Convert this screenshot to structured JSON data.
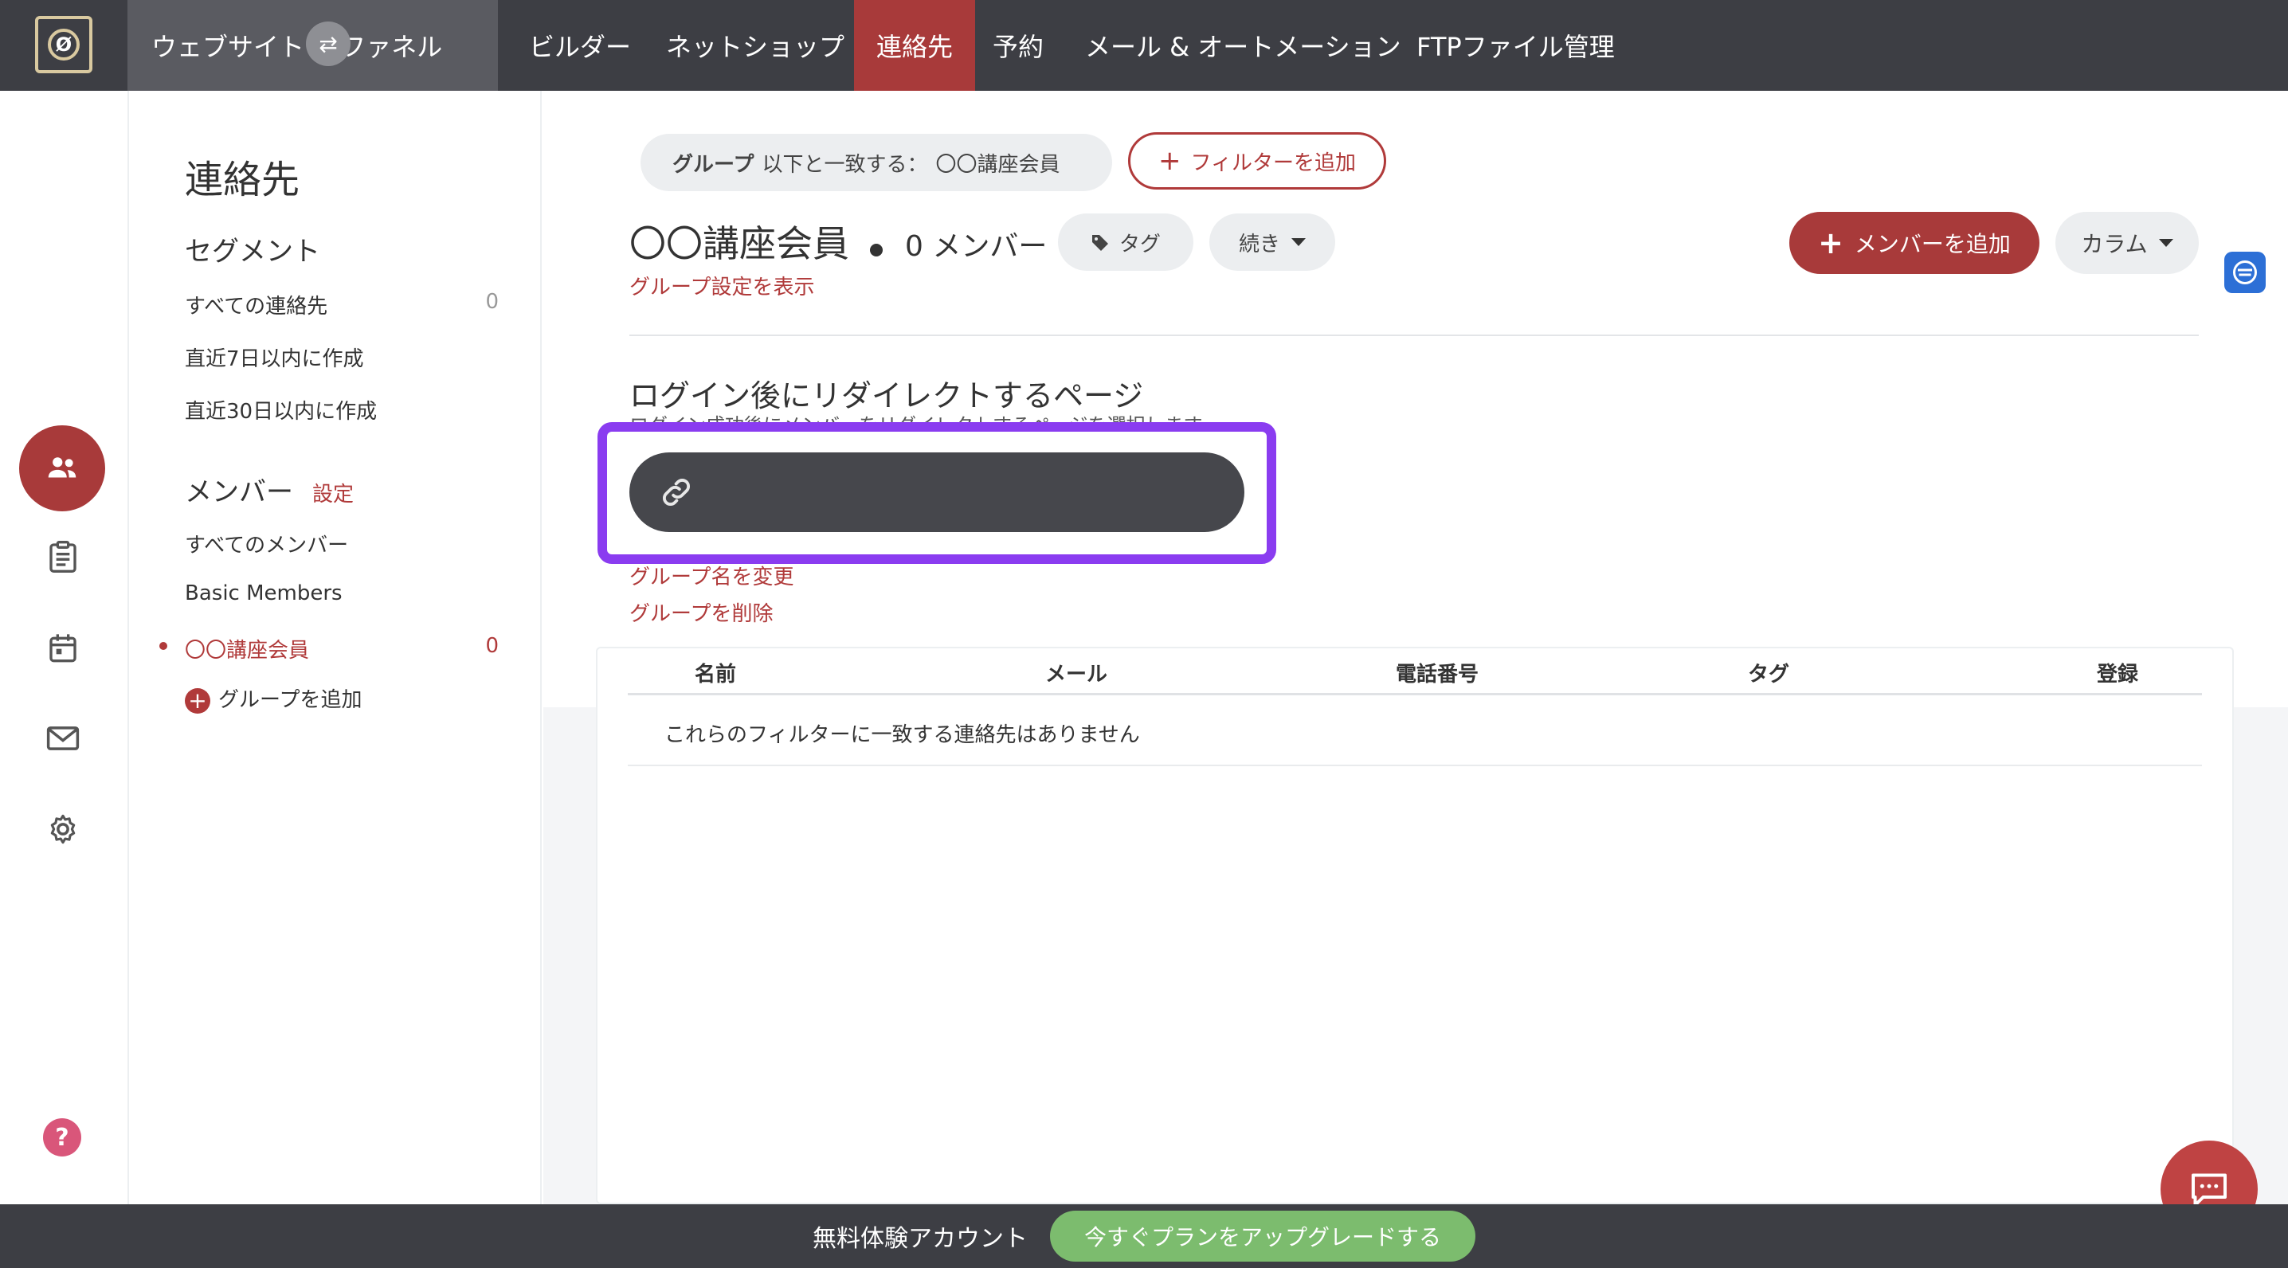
{
  "topnav": {
    "website_label": "ウェブサイト & ファネル",
    "items": [
      {
        "label": "ビルダー"
      },
      {
        "label": "ネットショップ"
      },
      {
        "label": "連絡先"
      },
      {
        "label": "予約"
      },
      {
        "label": "メール & オートメーション"
      },
      {
        "label": "FTPファイル管理"
      }
    ],
    "active_item": "連絡先"
  },
  "rail": {
    "icons": [
      "contacts-icon",
      "clipboard-icon",
      "calendar-icon",
      "mail-icon",
      "gear-icon"
    ],
    "active_icon": "contacts-icon",
    "help_label": "?"
  },
  "sidebar": {
    "title": "連絡先",
    "segments_heading": "セグメント",
    "segments": [
      {
        "label": "すべての連絡先",
        "count": "0"
      },
      {
        "label": "直近7日以内に作成"
      },
      {
        "label": "直近30日以内に作成"
      }
    ],
    "members_heading": "メンバー",
    "members_settings_link": "設定",
    "members": [
      {
        "label": "すべてのメンバー"
      },
      {
        "label": "Basic Members"
      },
      {
        "label": "〇〇講座会員",
        "count": "0",
        "selected": true
      }
    ],
    "add_group_label": "グループを追加"
  },
  "filter_bar": {
    "group_key": "グループ",
    "group_condition": "以下と一致する：",
    "group_value": "〇〇講座会員",
    "add_filter_label": "フィルターを追加"
  },
  "group_header": {
    "title": "〇〇講座会員",
    "member_count": "0 メンバー",
    "tag_label": "タグ",
    "more_label": "続き",
    "settings_link": "グループ設定を表示",
    "add_member_label": "メンバーを追加",
    "column_label": "カラム"
  },
  "redirect": {
    "title": "ログイン後にリダイレクトするページ",
    "description": "ログイン成功後にメンバーをリダイレクトするページを選択します",
    "url_value": ""
  },
  "group_actions": {
    "rename_link": "グループ名を変更",
    "delete_link": "グループを削除"
  },
  "table": {
    "columns": [
      "名前",
      "メール",
      "電話番号",
      "タグ",
      "登録"
    ],
    "empty_message": "これらのフィルターに一致する連絡先はありません"
  },
  "bottom_bar": {
    "trial_label": "無料体験アカウント",
    "upgrade_label": "今すぐプランをアップグレードする"
  },
  "colors": {
    "brand_red": "#a83a3a",
    "nav_bg": "#3d3e44",
    "highlight": "#8a3cf0",
    "upgrade_green": "#7cbc6e"
  }
}
